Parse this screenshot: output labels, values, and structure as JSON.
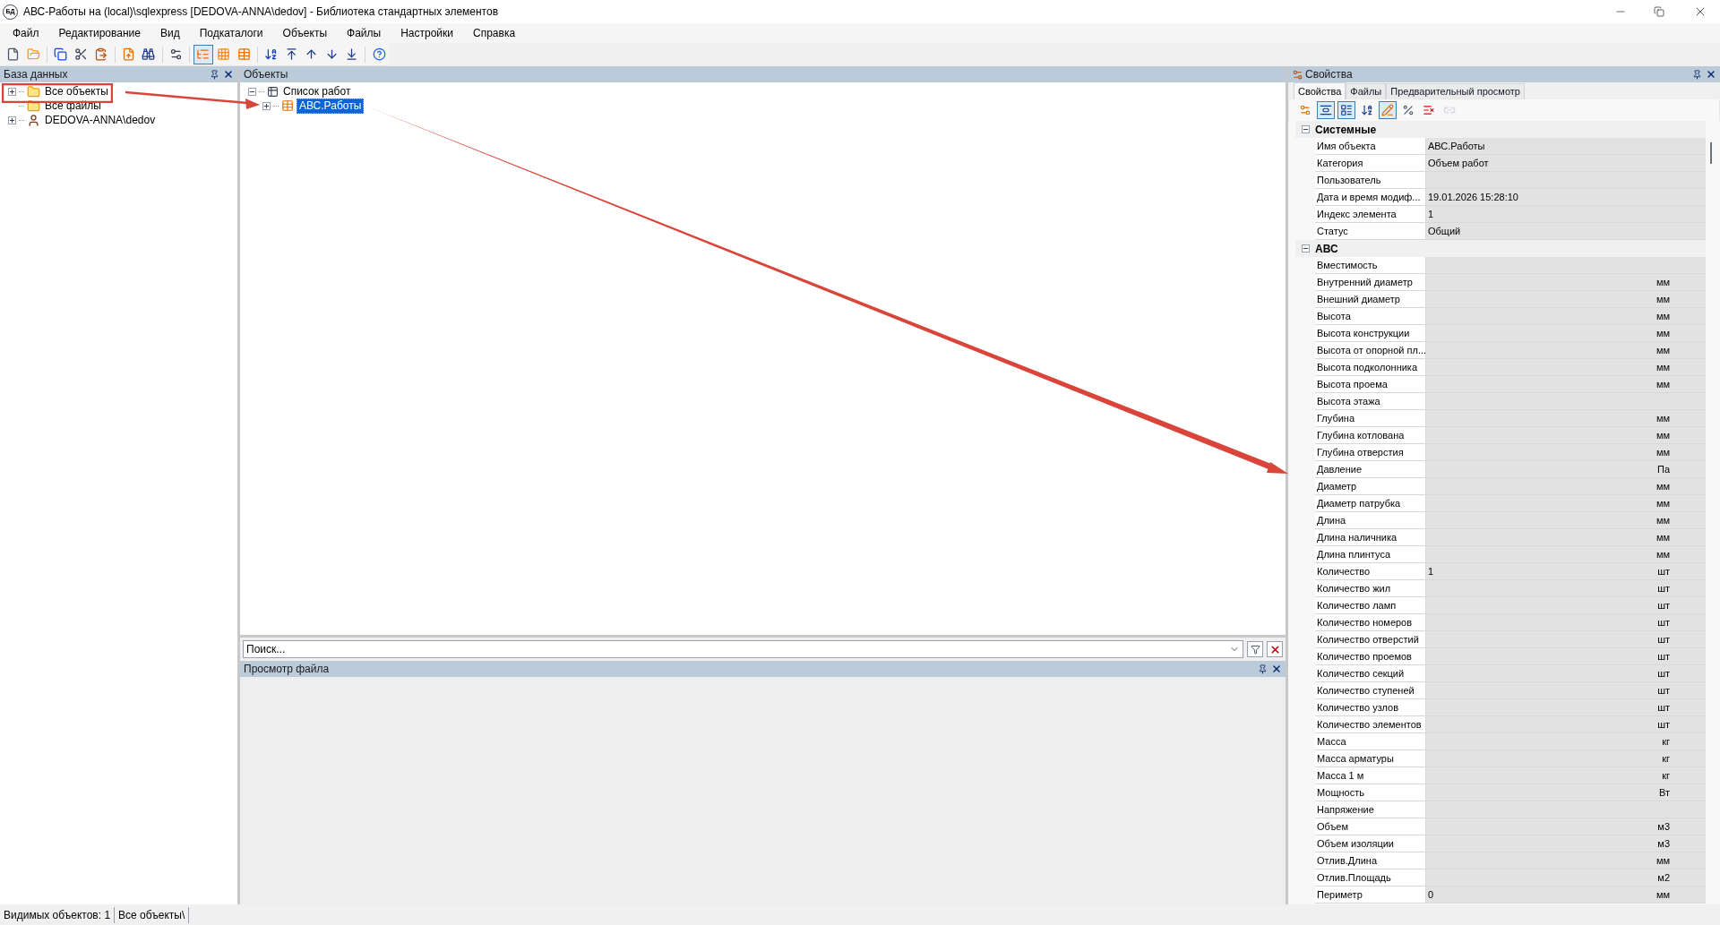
{
  "window": {
    "title": "АВС-Работы на (local)\\sqlexpress [DEDOVA-ANNA\\dedov] - Библиотека стандартных элементов",
    "logo": "БД"
  },
  "menu": [
    "Файл",
    "Редактирование",
    "Вид",
    "Подкаталоги",
    "Объекты",
    "Файлы",
    "Настройки",
    "Справка"
  ],
  "toolbar": [
    {
      "selected": false
    },
    {
      "selected": false
    },
    {
      "selected": false
    },
    {
      "selected": false
    },
    {
      "selected": false
    },
    {
      "selected": false
    },
    {
      "selected": false
    },
    {
      "selected": false
    },
    {
      "selected": true
    },
    {
      "selected": false
    },
    {
      "selected": false
    },
    {
      "selected": false
    },
    {
      "selected": false
    },
    {
      "selected": false
    },
    {
      "selected": false
    },
    {
      "selected": false
    },
    {
      "selected": false
    }
  ],
  "database_panel": {
    "title": "База данных",
    "tree": [
      {
        "label": "Все объекты",
        "expanded": false,
        "selected": false
      },
      {
        "label": "Все файлы",
        "selected": false
      },
      {
        "label": "DEDOVA-ANNA\\dedov",
        "expanded": false,
        "selected": false
      }
    ]
  },
  "objects_panel": {
    "title": "Объекты",
    "tree": [
      {
        "label": "Список работ",
        "expanded": true,
        "selected": false,
        "children": [
          {
            "label": "АВС.Работы",
            "expanded": false,
            "selected": true
          }
        ]
      }
    ]
  },
  "search": {
    "placeholder": "Поиск..."
  },
  "file_preview": {
    "title": "Просмотр файла"
  },
  "properties_panel": {
    "title": "Свойства",
    "tabs": [
      {
        "label": "Свойства",
        "selected": true
      },
      {
        "label": "Файлы",
        "selected": false
      },
      {
        "label": "Предварительный просмотр",
        "selected": false
      }
    ],
    "toolbar": [
      {
        "selected": false
      },
      {
        "selected": true
      },
      {
        "selected": true
      },
      {
        "selected": false
      },
      {
        "selected": true
      },
      {
        "selected": false
      },
      {
        "selected": false
      },
      {
        "selected": false
      }
    ],
    "groups": [
      {
        "name": "Системные",
        "expanded": true,
        "rows": [
          {
            "name": "Имя объекта",
            "value": "АВС.Работы"
          },
          {
            "name": "Категория",
            "value": "Объем работ"
          },
          {
            "name": "Пользователь"
          },
          {
            "name": "Дата и время модиф...",
            "value": "19.01.2026 15:28:10"
          },
          {
            "name": "Индекс элемента",
            "value": "1"
          },
          {
            "name": "Статус",
            "value": "Общий"
          }
        ]
      },
      {
        "name": "АВС",
        "expanded": true,
        "rows": [
          {
            "name": "Вместимость"
          },
          {
            "name": "Внутренний диаметр",
            "unit": "мм"
          },
          {
            "name": "Внешний диаметр",
            "unit": "мм"
          },
          {
            "name": "Высота",
            "unit": "мм"
          },
          {
            "name": "Высота конструкции",
            "unit": "мм"
          },
          {
            "name": "Высота от опорной пл...",
            "unit": "мм"
          },
          {
            "name": "Высота подколонника",
            "unit": "мм"
          },
          {
            "name": "Высота проема",
            "unit": "мм"
          },
          {
            "name": "Высота этажа"
          },
          {
            "name": "Глубина",
            "unit": "мм"
          },
          {
            "name": "Глубина котлована",
            "unit": "мм"
          },
          {
            "name": "Глубина отверстия",
            "unit": "мм"
          },
          {
            "name": "Давление",
            "unit": "Па"
          },
          {
            "name": "Диаметр",
            "unit": "мм"
          },
          {
            "name": "Диаметр патрубка",
            "unit": "мм"
          },
          {
            "name": "Длина",
            "unit": "мм"
          },
          {
            "name": "Длина наличника",
            "unit": "мм"
          },
          {
            "name": "Длина плинтуса",
            "unit": "мм"
          },
          {
            "name": "Количество",
            "value": "1",
            "unit": "шт"
          },
          {
            "name": "Количество жил",
            "unit": "шт"
          },
          {
            "name": "Количество ламп",
            "unit": "шт"
          },
          {
            "name": "Количество номеров",
            "unit": "шт"
          },
          {
            "name": "Количество отверстий",
            "unit": "шт"
          },
          {
            "name": "Количество проемов",
            "unit": "шт"
          },
          {
            "name": "Количество секций",
            "unit": "шт"
          },
          {
            "name": "Количество ступеней",
            "unit": "шт"
          },
          {
            "name": "Количество узлов",
            "unit": "шт"
          },
          {
            "name": "Количество элементов",
            "unit": "шт"
          },
          {
            "name": "Масса",
            "unit": "кг"
          },
          {
            "name": "Масса арматуры",
            "unit": "кг"
          },
          {
            "name": "Масса 1 м",
            "unit": "кг"
          },
          {
            "name": "Мощность",
            "unit": "Вт"
          },
          {
            "name": "Напряжение"
          },
          {
            "name": "Объем",
            "unit": "м3"
          },
          {
            "name": "Объем изоляции",
            "unit": "м3"
          },
          {
            "name": "Отлив.Длина",
            "unit": "мм"
          },
          {
            "name": "Отлив.Площадь",
            "unit": "м2"
          },
          {
            "name": "Периметр",
            "value": "0",
            "unit": "мм"
          }
        ]
      }
    ]
  },
  "status_bar": [
    "Видимых объектов: 1",
    "Все объекты\\"
  ]
}
